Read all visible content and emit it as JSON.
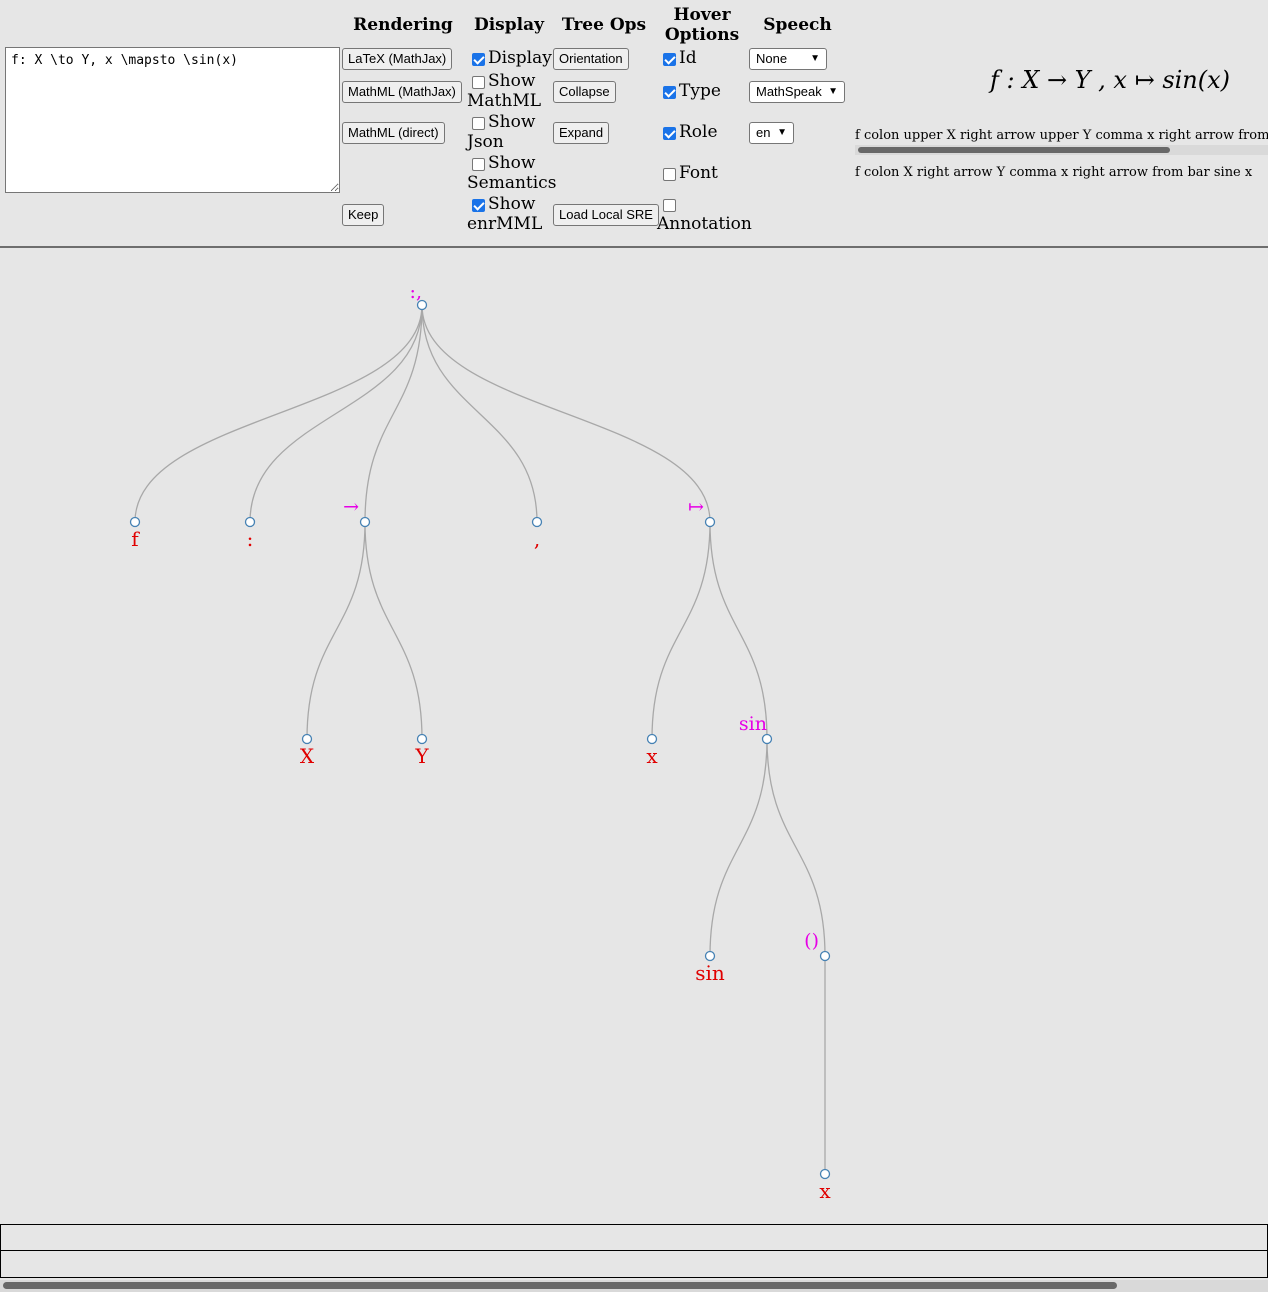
{
  "editor": {
    "input_value": "f: X \\to Y, x \\mapsto \\sin(x)"
  },
  "headers": {
    "rendering": "Rendering",
    "display": "Display",
    "tree_ops": "Tree Ops",
    "hover_line1": "Hover",
    "hover_line2": "Options",
    "speech": "Speech"
  },
  "rendering_buttons": {
    "latex": "LaTeX (MathJax)",
    "mathml_mathjax": "MathML (MathJax)",
    "mathml_direct": "MathML (direct)",
    "keep": "Keep"
  },
  "display_options": [
    {
      "line1": "Display",
      "line2": "",
      "checked": true
    },
    {
      "line1": "Show",
      "line2": "MathML",
      "checked": false
    },
    {
      "line1": "Show",
      "line2": "Json",
      "checked": false
    },
    {
      "line1": "Show",
      "line2": "Semantics",
      "checked": false
    },
    {
      "line1": "Show",
      "line2": "enrMML",
      "checked": true
    }
  ],
  "tree_ops_buttons": {
    "orientation": "Orientation",
    "collapse": "Collapse",
    "expand": "Expand",
    "load_local": "Load Local SRE"
  },
  "hover_options": [
    {
      "label": "Id",
      "checked": true
    },
    {
      "label": "Type",
      "checked": true
    },
    {
      "label": "Role",
      "checked": true
    },
    {
      "label": "Font",
      "checked": false
    },
    {
      "label": "Annotation",
      "checked": false
    }
  ],
  "speech_selects": {
    "engine": "None",
    "rules": "MathSpeak",
    "locale": "en"
  },
  "rendered_formula": {
    "text": "f : X → Y , x ↦ sin(x)"
  },
  "speech_output": {
    "line1": "f colon upper X right arrow upper Y comma x right arrow from bar sine x",
    "line2": "f colon X right arrow Y comma x right arrow from bar sine x"
  },
  "tree": {
    "nodes": [
      {
        "id": "root",
        "label": ":,",
        "kind": "operator"
      },
      {
        "id": "f",
        "label": "f",
        "kind": "leaf"
      },
      {
        "id": "colon",
        "label": ":",
        "kind": "leaf"
      },
      {
        "id": "arrow",
        "label": "→",
        "kind": "operator"
      },
      {
        "id": "comma",
        "label": ",",
        "kind": "leaf"
      },
      {
        "id": "mapsto",
        "label": "↦",
        "kind": "operator"
      },
      {
        "id": "X",
        "label": "X",
        "kind": "leaf"
      },
      {
        "id": "Y",
        "label": "Y",
        "kind": "leaf"
      },
      {
        "id": "x1",
        "label": "x",
        "kind": "leaf"
      },
      {
        "id": "sinop",
        "label": "sin",
        "kind": "operator"
      },
      {
        "id": "sinleaf",
        "label": "sin",
        "kind": "leaf"
      },
      {
        "id": "parens",
        "label": "()",
        "kind": "operator"
      },
      {
        "id": "x2",
        "label": "x",
        "kind": "leaf"
      }
    ],
    "edges": [
      [
        "root",
        "f"
      ],
      [
        "root",
        "colon"
      ],
      [
        "root",
        "arrow"
      ],
      [
        "root",
        "comma"
      ],
      [
        "root",
        "mapsto"
      ],
      [
        "arrow",
        "X"
      ],
      [
        "arrow",
        "Y"
      ],
      [
        "mapsto",
        "x1"
      ],
      [
        "mapsto",
        "sinop"
      ],
      [
        "sinop",
        "sinleaf"
      ],
      [
        "sinop",
        "parens"
      ],
      [
        "parens",
        "x2"
      ]
    ],
    "colors": {
      "operator": "#e600e6",
      "leaf": "#e00000",
      "edge": "#a8a8a8",
      "node_stroke": "#4682b4"
    }
  }
}
